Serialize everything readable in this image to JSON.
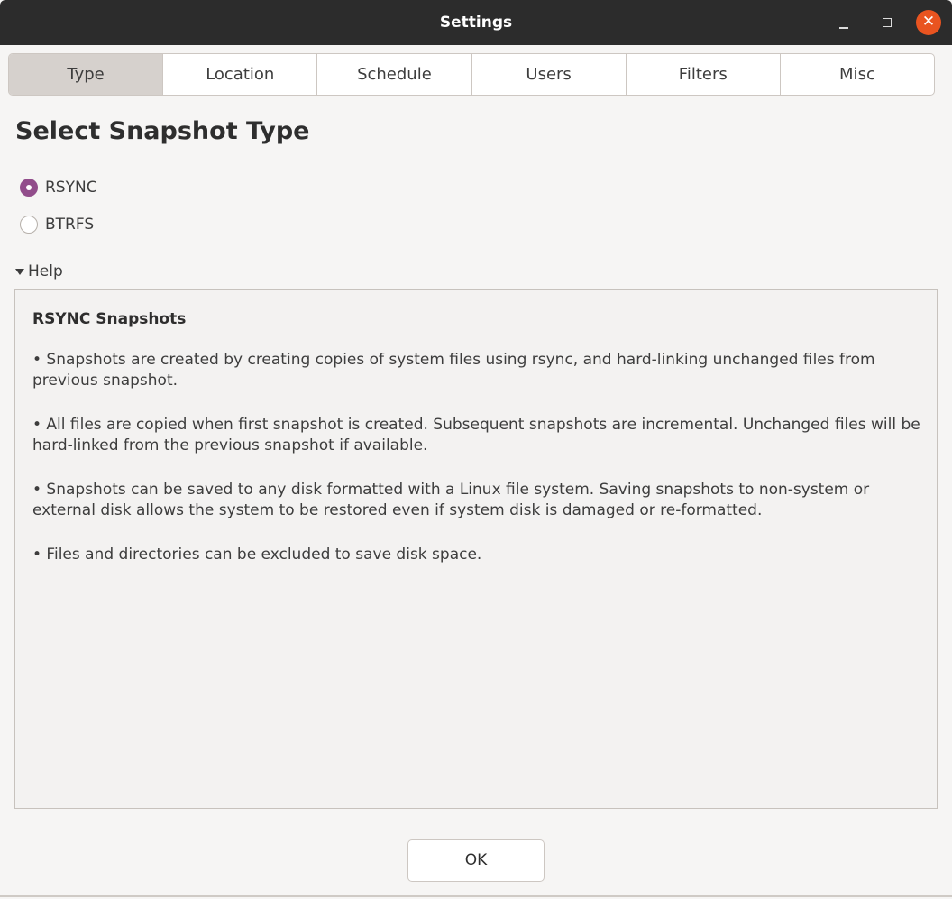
{
  "window": {
    "title": "Settings",
    "controls": {
      "minimize_glyph": "–",
      "maximize_glyph": "□",
      "close_glyph": "✕"
    }
  },
  "tabs": [
    {
      "label": "Type",
      "active": true
    },
    {
      "label": "Location",
      "active": false
    },
    {
      "label": "Schedule",
      "active": false
    },
    {
      "label": "Users",
      "active": false
    },
    {
      "label": "Filters",
      "active": false
    },
    {
      "label": "Misc",
      "active": false
    }
  ],
  "main": {
    "heading": "Select Snapshot Type",
    "options": [
      {
        "label": "RSYNC",
        "checked": true
      },
      {
        "label": "BTRFS",
        "checked": false
      }
    ],
    "help": {
      "toggle_label": "Help",
      "expanded": true,
      "title": "RSYNC Snapshots",
      "paragraphs": [
        "• Snapshots are created by creating copies of system files using rsync, and hard-linking unchanged files from previous snapshot.",
        "• All files are copied when first snapshot is created. Subsequent snapshots are incremental. Unchanged files will be hard-linked from the previous snapshot if available.",
        "• Snapshots can be saved to any disk formatted with a Linux file system. Saving snapshots to non-system or external disk allows the system to be restored even if system disk is damaged or re-formatted.",
        "• Files and directories can be excluded to save disk space."
      ]
    }
  },
  "footer": {
    "ok_label": "OK"
  },
  "colors": {
    "titlebar": "#2c2c2c",
    "accent_radio": "#924d8b",
    "close_button": "#e95420",
    "active_tab": "#d6d1cd",
    "window_bg": "#f6f5f4"
  },
  "icons": {
    "minimize": "minimize-icon",
    "maximize": "maximize-icon",
    "close": "close-icon",
    "expander": "triangle-down-icon"
  }
}
